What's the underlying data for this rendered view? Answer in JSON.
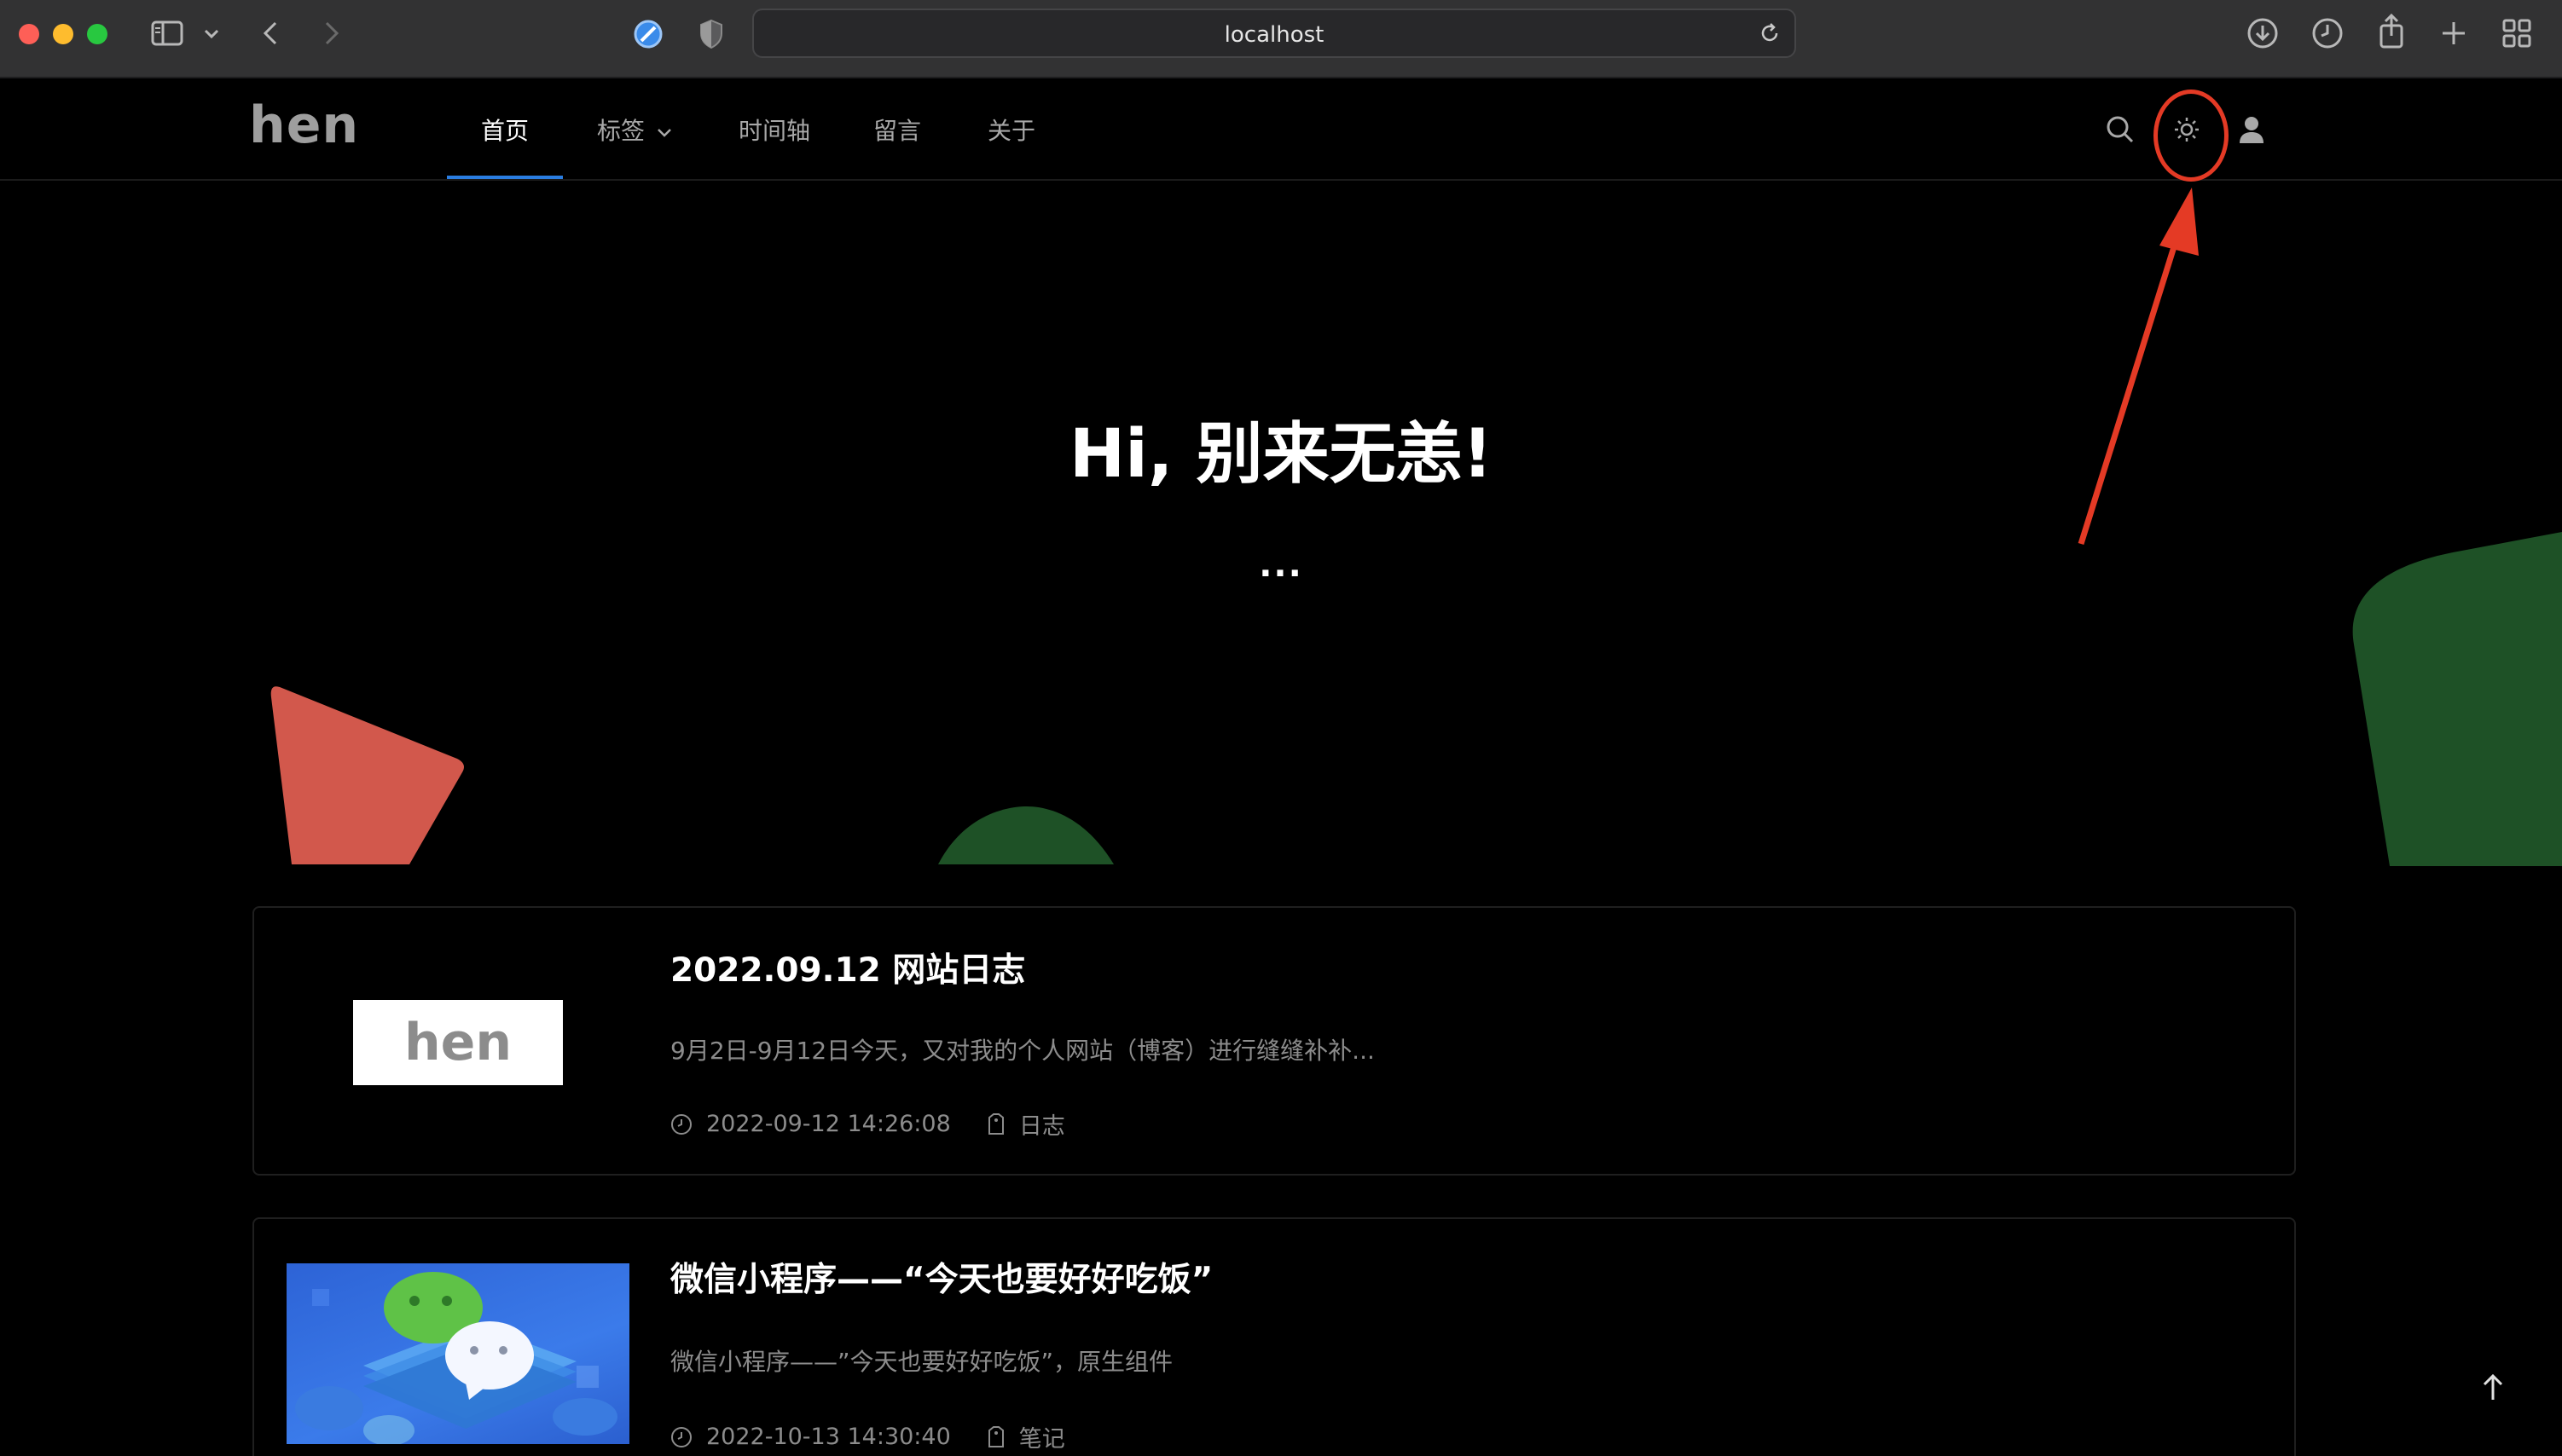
{
  "browser": {
    "url": "localhost",
    "accent_color": "#2a7de1"
  },
  "site": {
    "logo": "hen",
    "nav": [
      {
        "label": "首页",
        "active": true
      },
      {
        "label": "标签",
        "has_dropdown": true
      },
      {
        "label": "时间轴"
      },
      {
        "label": "留言"
      },
      {
        "label": "关于"
      }
    ],
    "header_icons": [
      "search-icon",
      "theme-toggle-sun-icon",
      "user-icon"
    ]
  },
  "hero": {
    "title": "Hi, 别来无恙!",
    "subtitle": "..."
  },
  "posts": [
    {
      "title": "2022.09.12 网站日志",
      "excerpt": "9月2日-9月12日今天，又对我的个人网站（博客）进行缝缝补补...",
      "date": "2022-09-12 14:26:08",
      "tag": "日志",
      "thumb_logo": "hen"
    },
    {
      "title": "微信小程序——“今天也要好好吃饭”",
      "excerpt": "微信小程序——”今天也要好好吃饭”，原生组件",
      "date": "2022-10-13 14:30:40",
      "tag": "笔记"
    }
  ],
  "annotation": {
    "color": "#e43a25",
    "target": "theme-toggle-sun-icon"
  }
}
